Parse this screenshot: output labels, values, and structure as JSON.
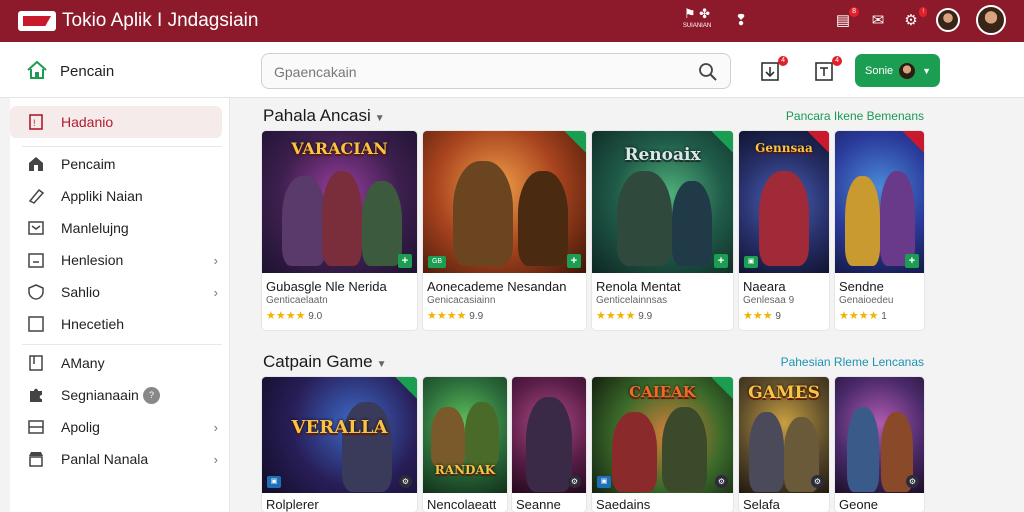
{
  "topbar": {
    "title": "Tokio Aplik I Jndagsiain",
    "center_label": "SUIANIAN",
    "notif_badge": "8"
  },
  "header": {
    "nav_label": "Pencain",
    "search_placeholder": "Gpaencakain",
    "btn1_badge": "4",
    "btn2_badge": "4",
    "cta_label": "Sonie"
  },
  "sidebar": {
    "items": [
      {
        "label": "Hadanio"
      },
      {
        "label": "Pencaim"
      },
      {
        "label": "Appliki Naian"
      },
      {
        "label": "Manlelujng"
      },
      {
        "label": "Henlesion"
      },
      {
        "label": "Sahlio"
      },
      {
        "label": "Hnecetieh"
      },
      {
        "label": "AMany"
      },
      {
        "label": "Segnianaain",
        "badge": "?"
      },
      {
        "label": "Apolig"
      },
      {
        "label": "Panlal Nanala"
      }
    ]
  },
  "sections": [
    {
      "title": "Pahala Ancasi",
      "link": "Pancara Ikene Bemenans"
    },
    {
      "title": "Catpain Game",
      "link": "Pahesian Rleme Lencanas"
    }
  ],
  "row1": [
    {
      "art": "VARACIAN",
      "name": "Gubasgle Nle Nerida",
      "sub": "Genticaelaatn",
      "stars": "★★★★",
      "rating": "9.0"
    },
    {
      "art": "",
      "name": "Aonecademe Nesandan",
      "sub": "Genicacasiainn",
      "stars": "★★★★",
      "rating": "9.9"
    },
    {
      "art": "Renoaix",
      "name": "Renola Mentat",
      "sub": "Genticelainnsas",
      "stars": "★★★★",
      "rating": "9.9"
    },
    {
      "art": "Gennsaa",
      "name": "Naeara",
      "sub": "Genlesaa 9",
      "stars": "★★★",
      "rating": "9"
    },
    {
      "art": "",
      "name": "Sendne",
      "sub": "Genaioedeu",
      "stars": "★★★★",
      "rating": "1"
    }
  ],
  "row2": [
    {
      "art": "VERALLA",
      "name": "Rolplerer"
    },
    {
      "art": "RANDAK",
      "name": "Nencolaeatt"
    },
    {
      "art": "",
      "name": "Seanne"
    },
    {
      "art": "CAIEAK",
      "name": "Saedains"
    },
    {
      "art": "GAMES",
      "name": "Selafa"
    },
    {
      "art": "",
      "name": "Geone"
    }
  ]
}
